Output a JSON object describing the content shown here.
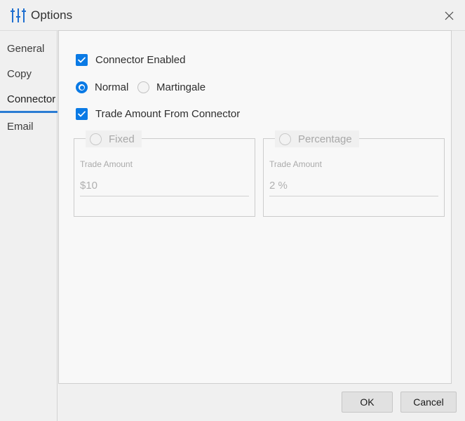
{
  "window": {
    "title": "Options",
    "icon": "sliders-icon",
    "close_icon": "close-icon",
    "accent_color": "#0a7ae5",
    "tab_indicator_color": "#2b7cd3"
  },
  "sidebar": {
    "items": [
      {
        "label": "General",
        "selected": false
      },
      {
        "label": "Copy",
        "selected": false
      },
      {
        "label": "Connector",
        "selected": true
      },
      {
        "label": "Email",
        "selected": false
      }
    ]
  },
  "main": {
    "connector_enabled": {
      "label": "Connector Enabled",
      "checked": true
    },
    "mode": {
      "options": [
        {
          "label": "Normal",
          "selected": true
        },
        {
          "label": "Martingale",
          "selected": false
        }
      ]
    },
    "trade_amount_from_connector": {
      "label": "Trade Amount From Connector",
      "checked": true
    },
    "groups": [
      {
        "title": "Fixed",
        "selected": false,
        "disabled": true,
        "field_label": "Trade Amount",
        "field_value": "$10"
      },
      {
        "title": "Percentage",
        "selected": false,
        "disabled": true,
        "field_label": "Trade Amount",
        "field_value": "2 %"
      }
    ]
  },
  "footer": {
    "ok_label": "OK",
    "cancel_label": "Cancel"
  }
}
